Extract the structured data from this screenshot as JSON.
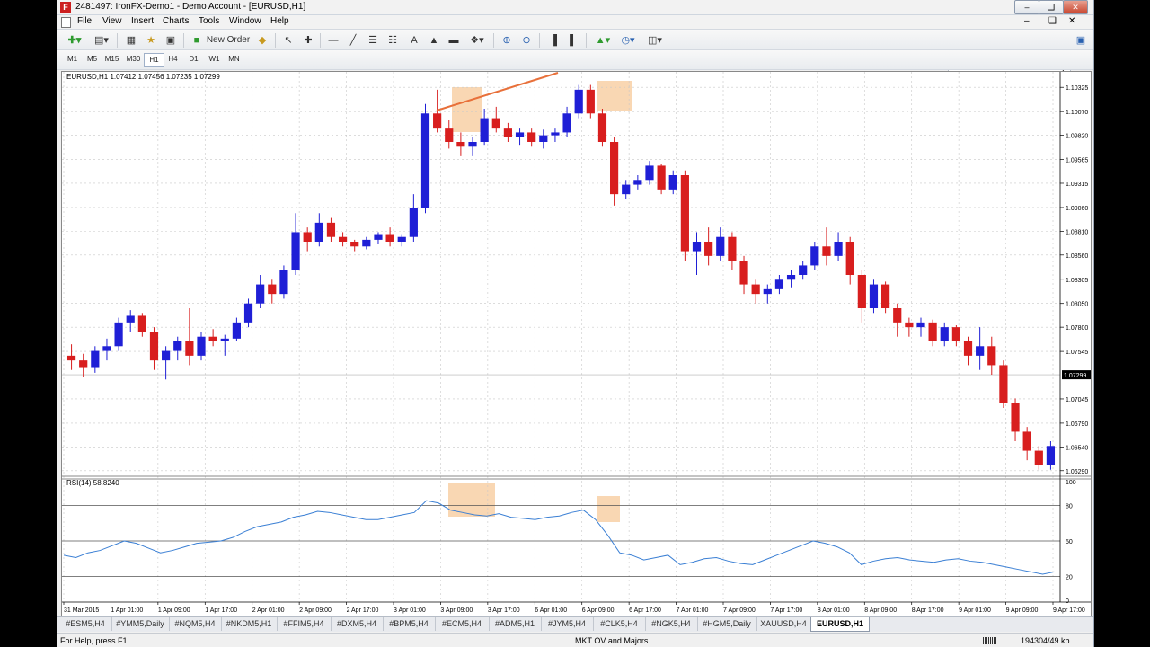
{
  "window": {
    "title": "2481497: IronFX-Demo1 - Demo Account - [EURUSD,H1]",
    "app_icon_letter": "F"
  },
  "menu": [
    "File",
    "View",
    "Insert",
    "Charts",
    "Tools",
    "Window",
    "Help"
  ],
  "toolbar": {
    "new_order_label": "New Order",
    "search_placeholder": ""
  },
  "timeframes": [
    "M1",
    "M5",
    "M15",
    "M30",
    "H1",
    "H4",
    "D1",
    "W1",
    "MN"
  ],
  "active_timeframe": "H1",
  "chart": {
    "header": "EURUSD,H1  1.07412 1.07456 1.07235 1.07299",
    "current_price_label": "1.07299",
    "price_labels": [
      "1.10325",
      "1.10070",
      "1.09820",
      "1.09565",
      "1.09315",
      "1.09060",
      "1.08810",
      "1.08560",
      "1.08305",
      "1.08050",
      "1.07800",
      "1.07545",
      "1.07045",
      "1.06790",
      "1.06540",
      "1.06290"
    ],
    "time_labels": [
      "31 Mar 2015",
      "1 Apr 01:00",
      "1 Apr 09:00",
      "1 Apr 17:00",
      "2 Apr 01:00",
      "2 Apr 09:00",
      "2 Apr 17:00",
      "3 Apr 01:00",
      "3 Apr 09:00",
      "3 Apr 17:00",
      "6 Apr 01:00",
      "6 Apr 09:00",
      "6 Apr 17:00",
      "7 Apr 01:00",
      "7 Apr 09:00",
      "7 Apr 17:00",
      "8 Apr 01:00",
      "8 Apr 09:00",
      "8 Apr 17:00",
      "9 Apr 01:00",
      "9 Apr 09:00",
      "9 Apr 17:00"
    ],
    "rsi_header": "RSI(14) 58.8240",
    "rsi_labels": [
      "100",
      "80",
      "50",
      "20",
      "0"
    ],
    "colors": {
      "bull": "#1f1fd6",
      "bear": "#d81e1e",
      "rsi_line": "#3a7fd4",
      "highlight": "#f7c99a",
      "trendline": "#e8703a"
    }
  },
  "tabs": [
    "#ESM5,H4",
    "#YMM5,Daily",
    "#NQM5,H4",
    "#NKDM5,H1",
    "#FFIM5,H4",
    "#DXM5,H4",
    "#BPM5,H4",
    "#ECM5,H4",
    "#ADM5,H1",
    "#JYM5,H4",
    "#CLK5,H4",
    "#NGK5,H4",
    "#HGM5,Daily",
    "XAUUSD,H4",
    "EURUSD,H1"
  ],
  "active_tab": "EURUSD,H1",
  "status": {
    "help": "For Help, press F1",
    "profile": "MKT OV and Majors",
    "traffic": "194304/49 kb"
  },
  "chart_data": {
    "type": "candlestick",
    "symbol": "EURUSD,H1",
    "ylim": [
      1.0625,
      1.1045
    ],
    "ohlc_approx": [
      [
        1.075,
        1.0762,
        1.0735,
        1.0745
      ],
      [
        1.0745,
        1.0752,
        1.0728,
        1.0738
      ],
      [
        1.0738,
        1.076,
        1.0732,
        1.0755
      ],
      [
        1.0755,
        1.0768,
        1.0745,
        1.076
      ],
      [
        1.076,
        1.079,
        1.0755,
        1.0785
      ],
      [
        1.0785,
        1.0798,
        1.0775,
        1.0792
      ],
      [
        1.0792,
        1.0795,
        1.077,
        1.0775
      ],
      [
        1.0775,
        1.078,
        1.0735,
        1.0745
      ],
      [
        1.0745,
        1.076,
        1.0725,
        1.0755
      ],
      [
        1.0755,
        1.077,
        1.0745,
        1.0765
      ],
      [
        1.0765,
        1.08,
        1.074,
        1.075
      ],
      [
        1.075,
        1.0775,
        1.0745,
        1.077
      ],
      [
        1.077,
        1.0778,
        1.076,
        1.0765
      ],
      [
        1.0765,
        1.0772,
        1.075,
        1.0768
      ],
      [
        1.0768,
        1.079,
        1.0765,
        1.0785
      ],
      [
        1.0785,
        1.081,
        1.078,
        1.0805
      ],
      [
        1.0805,
        1.0835,
        1.08,
        1.0825
      ],
      [
        1.0825,
        1.083,
        1.0805,
        1.0815
      ],
      [
        1.0815,
        1.0845,
        1.081,
        1.084
      ],
      [
        1.084,
        1.09,
        1.0835,
        1.088
      ],
      [
        1.088,
        1.0885,
        1.086,
        1.087
      ],
      [
        1.087,
        1.09,
        1.0865,
        1.089
      ],
      [
        1.089,
        1.0895,
        1.087,
        1.0875
      ],
      [
        1.0875,
        1.088,
        1.0865,
        1.087
      ],
      [
        1.087,
        1.0872,
        1.086,
        1.0865
      ],
      [
        1.0865,
        1.0875,
        1.0862,
        1.0872
      ],
      [
        1.0872,
        1.088,
        1.0868,
        1.0878
      ],
      [
        1.0878,
        1.0885,
        1.0865,
        1.087
      ],
      [
        1.087,
        1.0878,
        1.0865,
        1.0875
      ],
      [
        1.0875,
        1.092,
        1.087,
        1.0905
      ],
      [
        1.0905,
        1.1015,
        1.09,
        1.1005
      ],
      [
        1.1005,
        1.103,
        1.0985,
        1.099
      ],
      [
        1.099,
        1.0998,
        1.0968,
        1.0975
      ],
      [
        1.0975,
        1.0985,
        1.096,
        1.097
      ],
      [
        1.097,
        1.098,
        1.096,
        1.0975
      ],
      [
        1.0975,
        1.101,
        1.0972,
        1.1
      ],
      [
        1.1,
        1.1012,
        1.0985,
        1.099
      ],
      [
        1.099,
        1.0995,
        1.0975,
        1.098
      ],
      [
        1.098,
        1.099,
        1.0972,
        1.0985
      ],
      [
        1.0985,
        1.099,
        1.097,
        1.0975
      ],
      [
        1.0975,
        1.0988,
        1.0968,
        1.0982
      ],
      [
        1.0982,
        1.099,
        1.0975,
        1.0985
      ],
      [
        1.0985,
        1.1012,
        1.098,
        1.1005
      ],
      [
        1.1005,
        1.1035,
        1.1,
        1.103
      ],
      [
        1.103,
        1.1035,
        1.1,
        1.1005
      ],
      [
        1.1005,
        1.101,
        1.097,
        1.0975
      ],
      [
        1.0975,
        1.098,
        1.0908,
        1.092
      ],
      [
        1.092,
        1.0935,
        1.0915,
        1.093
      ],
      [
        1.093,
        1.094,
        1.0925,
        1.0935
      ],
      [
        1.0935,
        1.0955,
        1.093,
        1.095
      ],
      [
        1.095,
        1.0952,
        1.092,
        1.0925
      ],
      [
        1.0925,
        1.0945,
        1.092,
        1.094
      ],
      [
        1.094,
        1.0945,
        1.085,
        1.086
      ],
      [
        1.086,
        1.088,
        1.0835,
        1.087
      ],
      [
        1.087,
        1.0885,
        1.0845,
        1.0855
      ],
      [
        1.0855,
        1.0885,
        1.085,
        1.0875
      ],
      [
        1.0875,
        1.088,
        1.084,
        1.085
      ],
      [
        1.085,
        1.0855,
        1.0815,
        1.0825
      ],
      [
        1.0825,
        1.083,
        1.0805,
        1.0815
      ],
      [
        1.0815,
        1.0825,
        1.0805,
        1.082
      ],
      [
        1.082,
        1.0835,
        1.0815,
        1.083
      ],
      [
        1.083,
        1.084,
        1.0822,
        1.0835
      ],
      [
        1.0835,
        1.085,
        1.083,
        1.0845
      ],
      [
        1.0845,
        1.087,
        1.084,
        1.0865
      ],
      [
        1.0865,
        1.0885,
        1.0845,
        1.0855
      ],
      [
        1.0855,
        1.088,
        1.085,
        1.087
      ],
      [
        1.087,
        1.0875,
        1.0825,
        1.0835
      ],
      [
        1.0835,
        1.084,
        1.0785,
        1.08
      ],
      [
        1.08,
        1.083,
        1.0795,
        1.0825
      ],
      [
        1.0825,
        1.0828,
        1.0795,
        1.08
      ],
      [
        1.08,
        1.0805,
        1.077,
        1.0785
      ],
      [
        1.0785,
        1.079,
        1.077,
        1.078
      ],
      [
        1.078,
        1.079,
        1.077,
        1.0785
      ],
      [
        1.0785,
        1.0788,
        1.076,
        1.0765
      ],
      [
        1.0765,
        1.0785,
        1.076,
        1.078
      ],
      [
        1.078,
        1.0782,
        1.076,
        1.0765
      ],
      [
        1.0765,
        1.077,
        1.074,
        1.075
      ],
      [
        1.075,
        1.078,
        1.0735,
        1.076
      ],
      [
        1.076,
        1.077,
        1.073,
        1.074
      ],
      [
        1.074,
        1.0745,
        1.0695,
        1.07
      ],
      [
        1.07,
        1.0705,
        1.066,
        1.067
      ],
      [
        1.067,
        1.0675,
        1.064,
        1.065
      ],
      [
        1.065,
        1.0655,
        1.063,
        1.0635
      ],
      [
        1.0635,
        1.066,
        1.063,
        1.0655
      ]
    ],
    "rsi": [
      38,
      36,
      40,
      42,
      46,
      50,
      48,
      44,
      40,
      42,
      45,
      48,
      49,
      50,
      53,
      58,
      62,
      64,
      66,
      70,
      72,
      75,
      74,
      72,
      70,
      68,
      68,
      70,
      72,
      74,
      84,
      82,
      76,
      74,
      72,
      71,
      73,
      70,
      69,
      68,
      70,
      71,
      74,
      76,
      68,
      55,
      40,
      38,
      34,
      36,
      38,
      30,
      32,
      35,
      36,
      33,
      31,
      30,
      34,
      38,
      42,
      46,
      50,
      48,
      45,
      40,
      30,
      33,
      35,
      36,
      34,
      33,
      32,
      34,
      35,
      33,
      32,
      30,
      28,
      26,
      24,
      22,
      24
    ],
    "rsi_levels": [
      20,
      50,
      80
    ]
  }
}
